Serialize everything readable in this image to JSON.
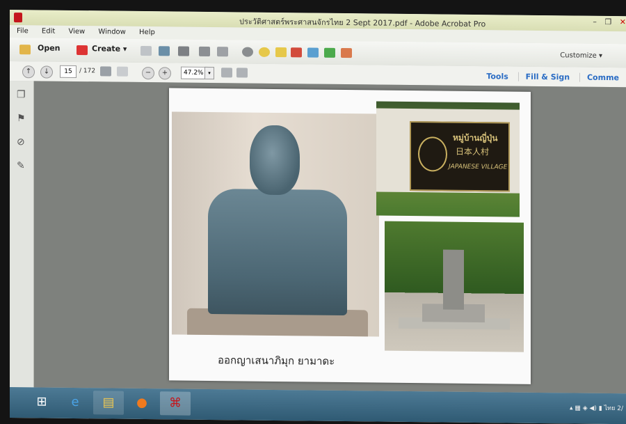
{
  "window": {
    "title": "ประวัติศาสตร์พระศาสนจักรไทย 2 Sept 2017.pdf - Adobe Acrobat Pro",
    "minimize": "–",
    "maximize": "❐",
    "close": "✕"
  },
  "menu": [
    "File",
    "Edit",
    "View",
    "Window",
    "Help"
  ],
  "toolbar": {
    "open_label": "Open",
    "create_label": "Create ▾",
    "customize_label": "Customize ▾"
  },
  "nav": {
    "up": "↑",
    "down": "↓",
    "page_current": "15",
    "page_total": "/ 172",
    "zoom_out": "−",
    "zoom_in": "+",
    "zoom_value": "47.2%",
    "zoom_dropdown": "▾"
  },
  "right_links": [
    "Tools",
    "Fill & Sign",
    "Comme"
  ],
  "slide": {
    "caption": "ออกญาเสนาภิมุก ยามาดะ",
    "sign_thai": "หมู่บ้านญี่ปุ่น",
    "sign_japanese": "日本人村",
    "sign_english": "JAPANESE VILLAGE"
  },
  "tray": {
    "language": "ไทย",
    "date_fragment": "2/"
  },
  "colors": {
    "acrobat_red": "#c4161c",
    "link_blue": "#2a6cc4",
    "taskbar": "#3a6580"
  }
}
